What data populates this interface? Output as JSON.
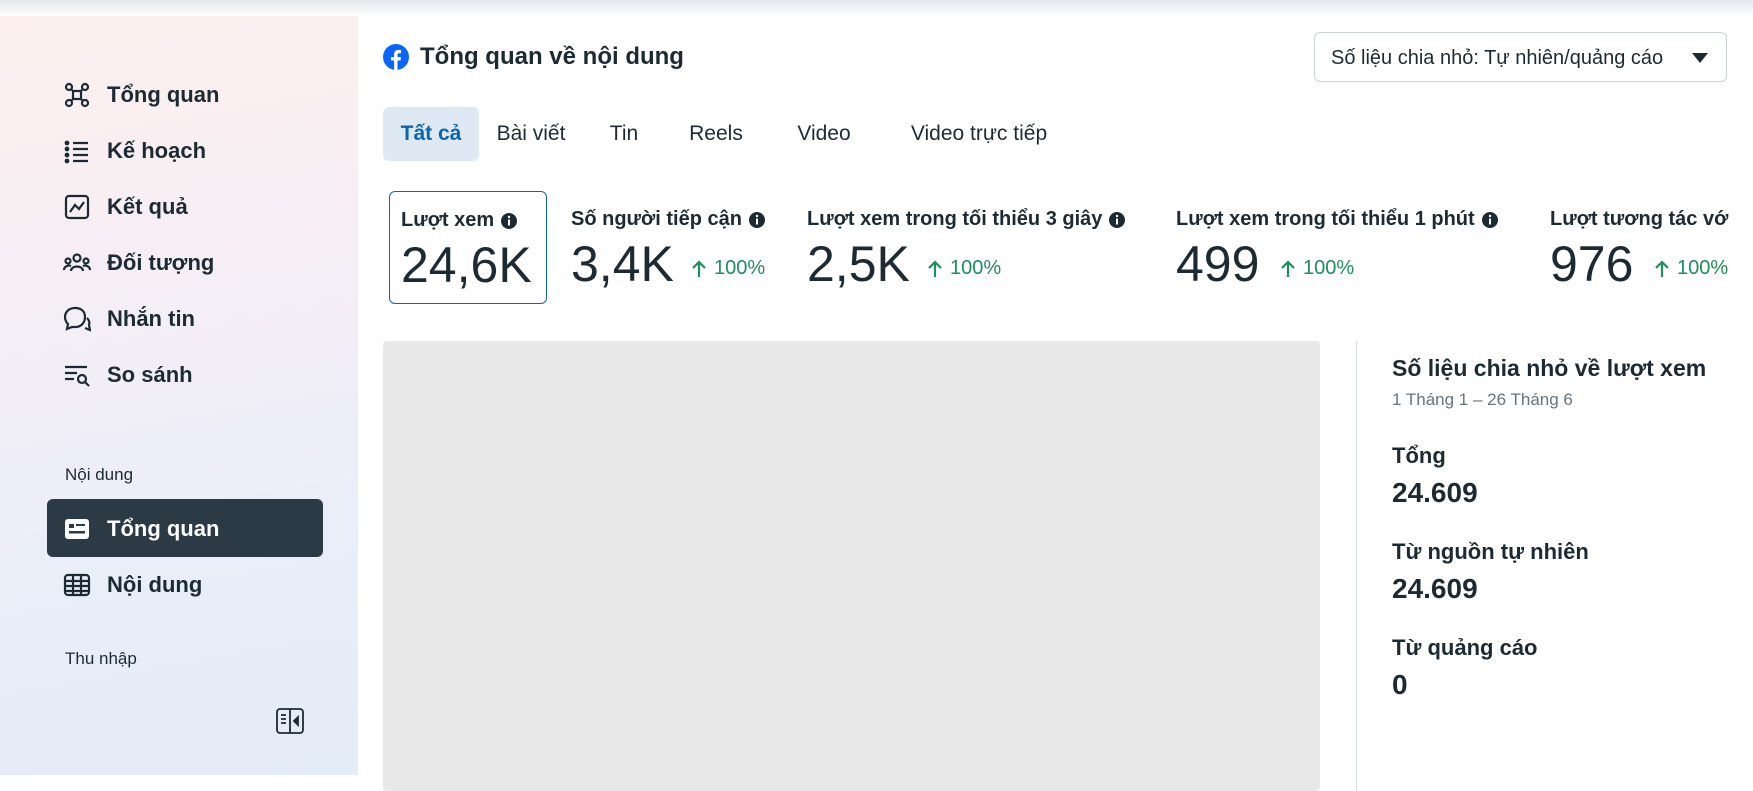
{
  "sidebar": {
    "items": [
      {
        "label": "Tổng quan",
        "icon": "overview-icon"
      },
      {
        "label": "Kế hoạch",
        "icon": "list-icon"
      },
      {
        "label": "Kết quả",
        "icon": "line-chart-icon"
      },
      {
        "label": "Đối tượng",
        "icon": "audience-icon"
      },
      {
        "label": "Nhắn tin",
        "icon": "chat-icon"
      },
      {
        "label": "So sánh",
        "icon": "compare-icon"
      }
    ],
    "section_content": "Nội dung",
    "content_items": [
      {
        "label": "Tổng quan",
        "icon": "content-overview-icon",
        "active": true
      },
      {
        "label": "Nội dung",
        "icon": "table-icon"
      }
    ],
    "section_income": "Thu nhập"
  },
  "header": {
    "title": "Tổng quan về nội dung",
    "dropdown_value": "Số liệu chia nhỏ: Tự nhiên/quảng cáo"
  },
  "tabs": [
    {
      "label": "Tất cả",
      "active": true
    },
    {
      "label": "Bài viết"
    },
    {
      "label": "Tin"
    },
    {
      "label": "Reels"
    },
    {
      "label": "Video"
    },
    {
      "label": "Video trực tiếp"
    }
  ],
  "metrics": [
    {
      "label": "Lượt xem",
      "value": "24,6K",
      "selected": true
    },
    {
      "label": "Số người tiếp cận",
      "value": "3,4K",
      "delta": "100%"
    },
    {
      "label": "Lượt xem trong tối thiểu 3 giây",
      "value": "2,5K",
      "delta": "100%"
    },
    {
      "label": "Lượt xem trong tối thiểu 1 phút",
      "value": "499",
      "delta": "100%"
    },
    {
      "label": "Lượt tương tác vớ",
      "value": "976",
      "delta": "100%"
    }
  ],
  "breakdown": {
    "title": "Số liệu chia nhỏ về lượt xem",
    "date_range": "1 Tháng 1 – 26 Tháng 6",
    "total_label": "Tổng",
    "total_value": "24.609",
    "organic_label": "Từ nguồn tự nhiên",
    "organic_value": "24.609",
    "ads_label": "Từ quảng cáo",
    "ads_value": "0"
  },
  "colors": {
    "accent": "#0a66b2",
    "positive": "#1e8e5e",
    "active_nav_bg": "#2b3a44",
    "facebook_blue": "#0866ff"
  }
}
